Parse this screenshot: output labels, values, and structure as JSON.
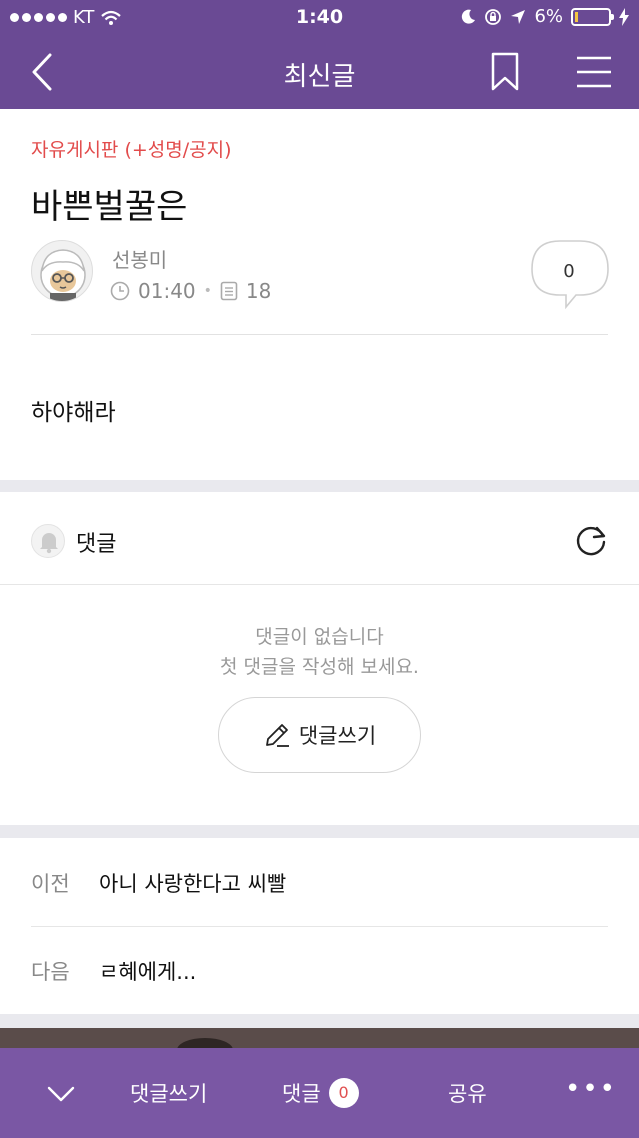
{
  "status_bar": {
    "carrier": "KT",
    "time": "1:40",
    "battery": "6%"
  },
  "nav": {
    "title": "최신글"
  },
  "post": {
    "board": "자유게시판 (+성명/공지)",
    "title": "바쁜벌꿀은",
    "author": "선봉미",
    "time": "01:40",
    "views": "18",
    "comment_count": "0",
    "body": "하야해라"
  },
  "comments": {
    "label": "댓글",
    "empty_line1": "댓글이 없습니다",
    "empty_line2": "첫 댓글을 작성해 보세요.",
    "write_button": "댓글쓰기"
  },
  "adjacent": {
    "prev_label": "이전",
    "prev_title": "아니 사랑한다고 씨빨",
    "next_label": "다음",
    "next_title": "ㄹ혜에게..."
  },
  "toolbar": {
    "write": "댓글쓰기",
    "comments": "댓글",
    "comment_badge": "0",
    "share": "공유",
    "more": "•••"
  },
  "colors": {
    "header_purple": "#6a4a94",
    "toolbar_purple": "#7a57a4",
    "board_red": "#e24b4b"
  }
}
